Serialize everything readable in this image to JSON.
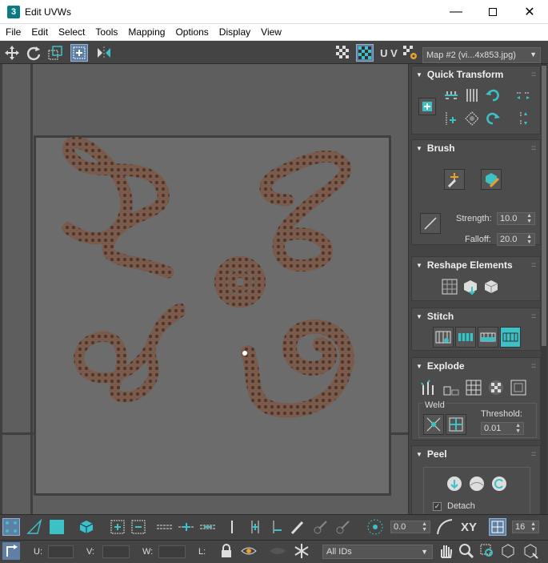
{
  "window": {
    "title": "Edit UVWs",
    "app_icon_label": "3",
    "controls": [
      "minimize-icon",
      "maximize-icon",
      "close-icon"
    ]
  },
  "menu": [
    "File",
    "Edit",
    "Select",
    "Tools",
    "Mapping",
    "Options",
    "Display",
    "View"
  ],
  "toolbar": {
    "uv_label": "U V",
    "map_selector": "Map #2 (vi...4x853.jpg)"
  },
  "rollouts": {
    "quick_transform": {
      "title": "Quick Transform"
    },
    "brush": {
      "title": "Brush",
      "strength_label": "Strength:",
      "strength_value": "10.0",
      "falloff_label": "Falloff:",
      "falloff_value": "20.0"
    },
    "reshape": {
      "title": "Reshape Elements"
    },
    "stitch": {
      "title": "Stitch"
    },
    "explode": {
      "title": "Explode",
      "weld_label": "Weld",
      "threshold_label": "Threshold:",
      "threshold_value": "0.01"
    },
    "peel": {
      "title": "Peel",
      "detach_label": "Detach"
    }
  },
  "bottom": {
    "rotate_value": "0.0",
    "xy_label": "XY",
    "grid_value": "16",
    "u_label": "U:",
    "v_label": "V:",
    "w_label": "W:",
    "l_label": "L:",
    "id_filter": "All IDs"
  },
  "colors": {
    "accent_teal": "#3cc1c6",
    "active_blue": "#5f7fa4",
    "snake_brown": "#7a5a4a"
  }
}
